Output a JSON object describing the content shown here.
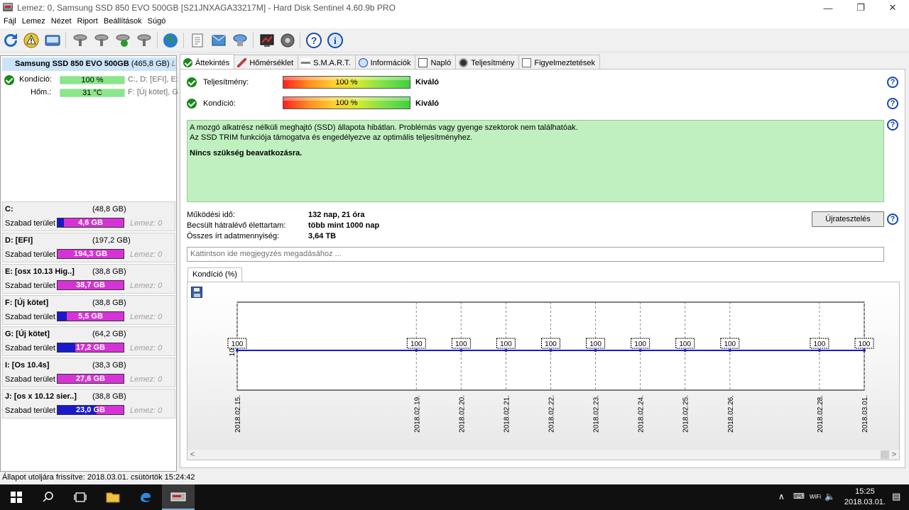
{
  "window": {
    "title": "Lemez: 0, Samsung SSD 850 EVO 500GB [S21JNXAGA33217M]  -  Hard Disk Sentinel 4.60.9b PRO",
    "minimize": "—",
    "maximize": "❐",
    "close": "✕"
  },
  "menu": [
    "Fájl",
    "Lemez",
    "Nézet",
    "Riport",
    "Beállítások",
    "Súgó"
  ],
  "toolbar_icons": [
    "refresh-icon",
    "warning-icon",
    "disk-image-icon",
    "disk-tool-icon",
    "disk-tool-icon",
    "disk-check-icon",
    "disk-tool-icon",
    "globe-icon",
    "report-icon",
    "send-icon",
    "disk-send-icon",
    "test-icon",
    "settings-icon",
    "help-icon",
    "info-icon"
  ],
  "disk": {
    "name": "Samsung SSD 850 EVO 500GB",
    "size": "(465,8 GB)",
    "extra": "Le",
    "condition_label": "Kondíció:",
    "condition_value": "100 %",
    "condition_drives": "C:, D: [EFI], E:",
    "temp_label": "Hőm.:",
    "temp_value": "31 °C",
    "temp_drives": "F: [Új kötet], G"
  },
  "partitions": [
    {
      "name": "C:",
      "size": "(48,8 GB)",
      "free_label": "Szabad terület",
      "free": "4,6 GB",
      "free_fraction": 0.094,
      "disk": "Lemez: 0",
      "color": "#1a1acc"
    },
    {
      "name": "D: [EFI]",
      "size": "(197,2 GB)",
      "free_label": "Szabad terület",
      "free": "194,3 GB",
      "free_fraction": 0.985,
      "disk": "Lemez: 0",
      "color": "#d633d6"
    },
    {
      "name": "E: [osx 10.13 Hig..]",
      "size": "(38,8 GB)",
      "free_label": "Szabad terület",
      "free": "38,7 GB",
      "free_fraction": 0.997,
      "disk": "Lemez: 0",
      "color": "#d633d6"
    },
    {
      "name": "F: [Új kötet]",
      "size": "(38,8 GB)",
      "free_label": "Szabad terület",
      "free": "5,5 GB",
      "free_fraction": 0.142,
      "disk": "Lemez: 0",
      "color": "#1a1acc"
    },
    {
      "name": "G: [Új kötet]",
      "size": "(64,2 GB)",
      "free_label": "Szabad terület",
      "free": "17,2 GB",
      "free_fraction": 0.268,
      "disk": "Lemez: 0",
      "color": "#1a1acc"
    },
    {
      "name": "I: [Os 10.4s]",
      "size": "(38,3 GB)",
      "free_label": "Szabad terület",
      "free": "27,6 GB",
      "free_fraction": 0.72,
      "disk": "Lemez: 0",
      "color": "#d633d6"
    },
    {
      "name": "J: [os x 10.12 sier..]",
      "size": "(38,8 GB)",
      "free_label": "Szabad terület",
      "free": "23,0 GB",
      "free_fraction": 0.593,
      "disk": "Lemez: 0",
      "color": "#1a1acc"
    }
  ],
  "tabs": [
    "Áttekintés",
    "Hőmérséklet",
    "S.M.A.R.T.",
    "Információk",
    "Napló",
    "Teljesítmény",
    "Figyelmeztetések"
  ],
  "overview": {
    "perf_label": "Teljesítmény:",
    "perf_value": "100 %",
    "perf_fraction": 1.0,
    "perf_rating": "Kiváló",
    "cond_label": "Kondíció:",
    "cond_value": "100 %",
    "cond_fraction": 1.0,
    "cond_rating": "Kiváló",
    "desc_line1": "A mozgó alkatrész nélküli meghajtó (SSD) állapota hibátlan. Problémás vagy gyenge szektorok nem találhatóak.",
    "desc_line2": "Az SSD TRIM funkciója támogatva és engedélyezve az optimális teljesítményhez.",
    "desc_line3": "Nincs szükség beavatkozásra.",
    "power_on_label": "Működési idő:",
    "power_on_value": "132 nap, 21 óra",
    "remaining_label": "Becsült hátralévő élettartam:",
    "remaining_value": "több mint 1000 nap",
    "written_label": "Összes írt adatmennyiség:",
    "written_value": "3,64 TB",
    "retest_button": "Újratesztelés",
    "comment_placeholder": "Kattintson ide megjegyzés megadásához ...",
    "help": "?"
  },
  "chart_tab": "Kondíció  (%)",
  "chart_data": {
    "type": "line",
    "x": [
      "2018.02.15.",
      "2018.02.19.",
      "2018.02.20.",
      "2018.02.21.",
      "2018.02.22.",
      "2018.02.23.",
      "2018.02.24.",
      "2018.02.25.",
      "2018.02.26.",
      "2018.02.28.",
      "2018.03.01."
    ],
    "x_days": [
      0,
      4,
      5,
      6,
      7,
      8,
      9,
      10,
      11,
      13,
      14
    ],
    "values": [
      100,
      100,
      100,
      100,
      100,
      100,
      100,
      100,
      100,
      100,
      100
    ],
    "y_tick": "100",
    "color": "#1a1acc"
  },
  "statusbar": "Állapot utoljára frissítve: 2018.03.01. csütörtök 15:24:42",
  "taskbar": {
    "time": "15:25",
    "date": "2018.03.01.",
    "tray_up": "∧",
    "tray_lang": "⌨",
    "tray_net": "WiFi",
    "tray_vol": "🔈",
    "tray_notif": "▤"
  }
}
